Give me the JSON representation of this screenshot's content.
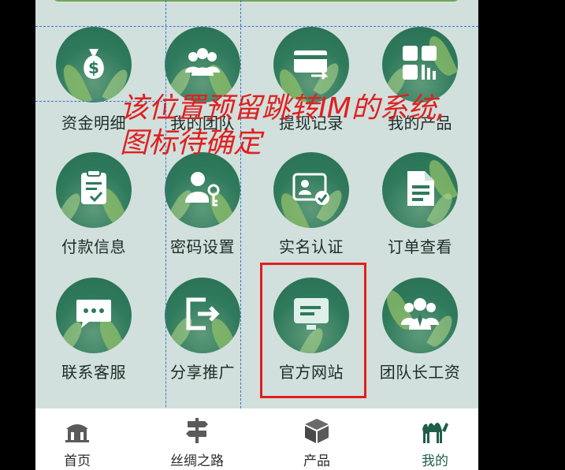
{
  "grid": [
    {
      "label": "资金明细",
      "icon": "money-bag-icon"
    },
    {
      "label": "我的团队",
      "icon": "team-icon"
    },
    {
      "label": "提现记录",
      "icon": "withdraw-card-icon"
    },
    {
      "label": "我的产品",
      "icon": "products-grid-icon"
    },
    {
      "label": "付款信息",
      "icon": "clipboard-check-icon"
    },
    {
      "label": "密码设置",
      "icon": "user-key-icon"
    },
    {
      "label": "实名认证",
      "icon": "id-card-check-icon"
    },
    {
      "label": "订单查看",
      "icon": "document-icon"
    },
    {
      "label": "联系客服",
      "icon": "chat-bubble-icon"
    },
    {
      "label": "分享推广",
      "icon": "share-arrow-icon"
    },
    {
      "label": "官方网站",
      "icon": "website-screen-icon"
    },
    {
      "label": "团队长工资",
      "icon": "team-leader-icon"
    }
  ],
  "annotation": {
    "line1": "该位置预留跳转IM的系统,",
    "line2": "图标待确定"
  },
  "tabbar": [
    {
      "label": "首页",
      "icon": "home-icon",
      "active": false
    },
    {
      "label": "丝绸之路",
      "icon": "signpost-icon",
      "active": false
    },
    {
      "label": "产品",
      "icon": "box-icon",
      "active": false
    },
    {
      "label": "我的",
      "icon": "camel-icon",
      "active": true
    }
  ],
  "colors": {
    "background": "#d1e0dc",
    "circle": "#2f7a5c",
    "annotation": "#e02020",
    "highlight_box": "#e31e1e",
    "active_tab": "#1f5e4b"
  }
}
